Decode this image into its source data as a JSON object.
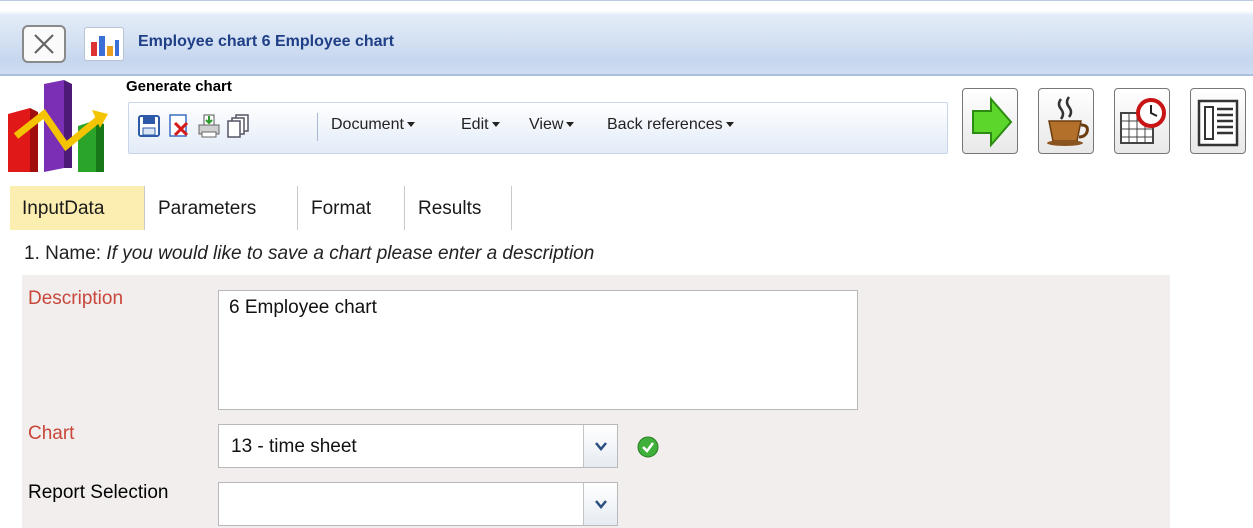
{
  "window": {
    "title": "Employee chart 6 Employee chart",
    "close_icon": "close-icon",
    "app_icon": "bar-chart-icon"
  },
  "header": {
    "label": "Generate chart",
    "logo_icon": "chart-logo-icon",
    "toolbar_icons": [
      "save-icon",
      "delete-icon",
      "print-icon",
      "copy-icon"
    ],
    "menus": [
      {
        "label": "Document"
      },
      {
        "label": "Edit"
      },
      {
        "label": "View"
      },
      {
        "label": "Back references"
      }
    ],
    "action_buttons": [
      "run-arrow-icon",
      "coffee-icon",
      "schedule-clock-icon",
      "report-list-icon"
    ]
  },
  "tabs": [
    {
      "label": "InputData",
      "active": true
    },
    {
      "label": "Parameters",
      "active": false
    },
    {
      "label": "Format",
      "active": false
    },
    {
      "label": "Results",
      "active": false
    }
  ],
  "section": {
    "prefix": "1. Name:",
    "hint": "If you would like to save a chart please enter a description"
  },
  "form": {
    "description": {
      "label": "Description",
      "value": "6 Employee chart"
    },
    "chart": {
      "label": "Chart",
      "value": "13 - time sheet",
      "status_icon": "check-ok-icon"
    },
    "report_selection": {
      "label": "Report Selection",
      "value": ""
    }
  },
  "colors": {
    "title_text": "#1f3f86",
    "required_label": "#c8463a",
    "active_tab": "#fbeeb0",
    "panel_bg": "#f1eeed"
  }
}
